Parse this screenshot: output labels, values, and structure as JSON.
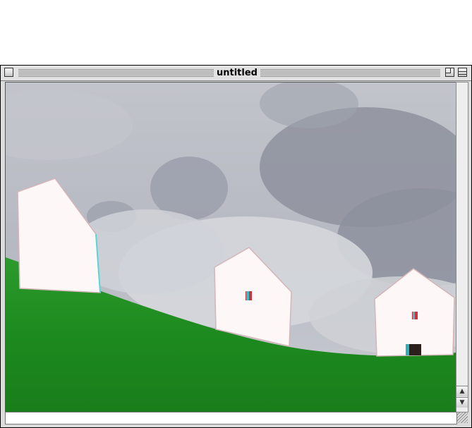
{
  "window": {
    "title": "untitled",
    "icons": {
      "close": "close-box-icon",
      "zoom": "zoom-box-icon",
      "windowshade": "windowshade-box-icon",
      "scroll_up": "scroll-up-arrow-icon",
      "scroll_down": "scroll-down-arrow-icon",
      "grow": "resize-grip-icon"
    },
    "glyphs": {
      "up": "▲",
      "down": "▼"
    }
  },
  "image": {
    "description_colors": {
      "sky": "#a9adb8",
      "grass": "#1f8a1f",
      "house": "#fdf6f6"
    }
  }
}
